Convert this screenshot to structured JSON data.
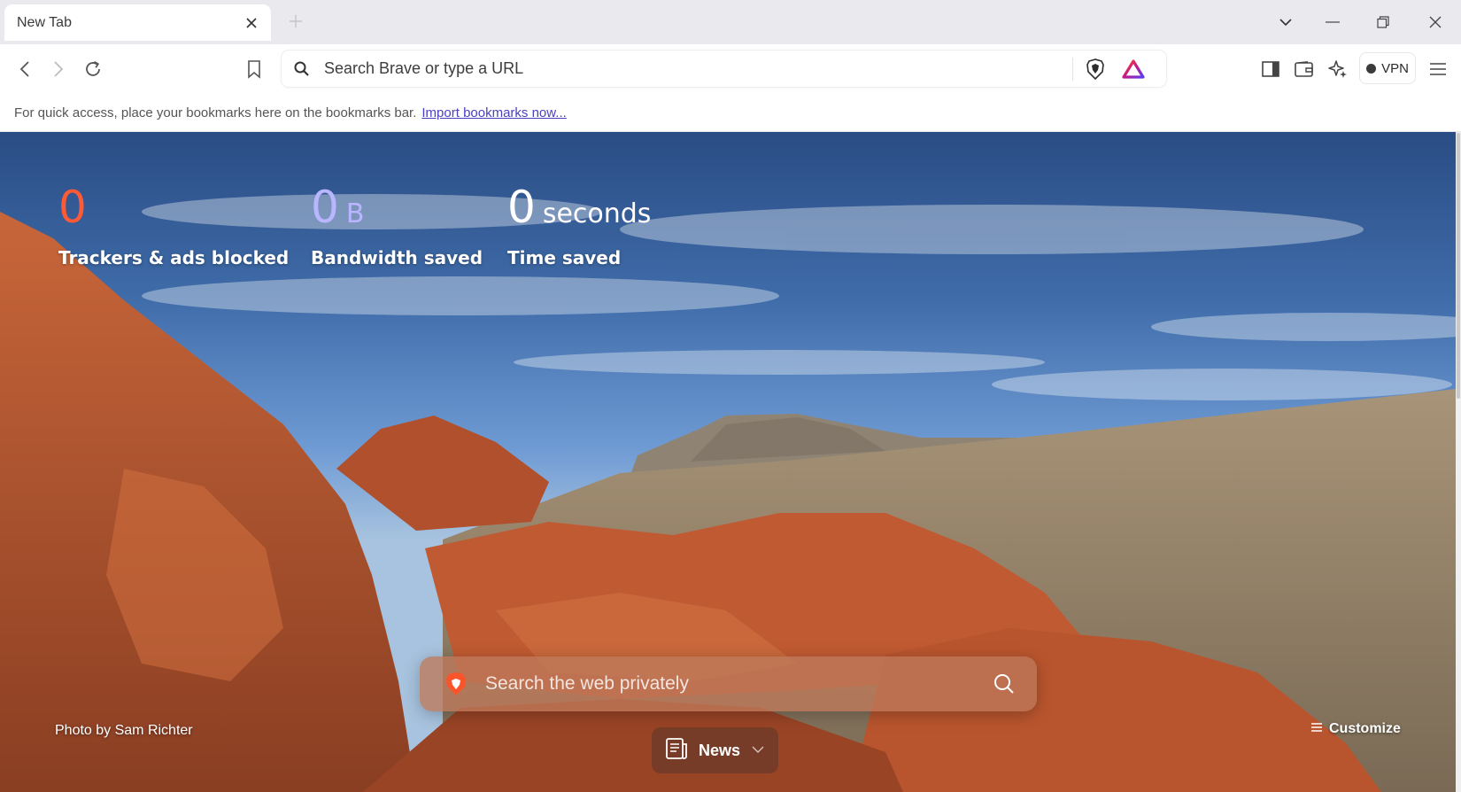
{
  "tab": {
    "title": "New Tab"
  },
  "omnibox": {
    "placeholder": "Search Brave or type a URL"
  },
  "toolbar": {
    "vpn_label": "VPN"
  },
  "bookmarks_bar": {
    "message": "For quick access, place your bookmarks here on the bookmarks bar.",
    "import_link": "Import bookmarks now..."
  },
  "stats": [
    {
      "value": "0",
      "unit": "",
      "label": "Trackers & ads blocked",
      "color": "#ff5a36"
    },
    {
      "value": "0",
      "unit": "B",
      "label": "Bandwidth saved",
      "color": "#b9b6ff"
    },
    {
      "value": "0",
      "unit": "seconds",
      "label": "Time saved",
      "color": "#ffffff"
    }
  ],
  "search": {
    "placeholder": "Search the web privately"
  },
  "photo_credit": "Photo by Sam Richter",
  "customize_label": "Customize",
  "news_label": "News",
  "colors": {
    "brave_orange": "#fb542b",
    "accent_purple": "#4a3fc2"
  }
}
